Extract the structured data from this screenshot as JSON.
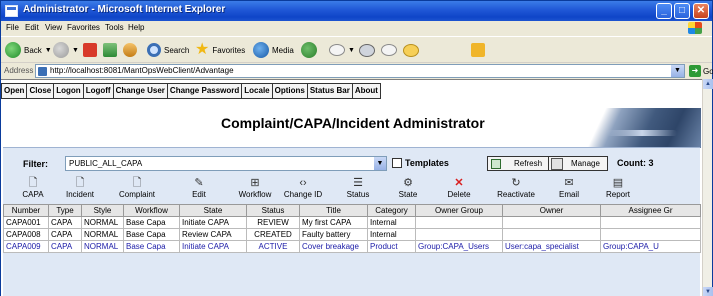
{
  "window": {
    "title": "Administrator - Microsoft Internet Explorer"
  },
  "menubar": [
    "File",
    "Edit",
    "View",
    "Favorites",
    "Tools",
    "Help"
  ],
  "toolbar": {
    "back": "Back",
    "search": "Search",
    "favorites": "Favorites",
    "media": "Media"
  },
  "address": {
    "label": "Address",
    "url": "http://localhost:8081/MantOpsWebClient/Advantage",
    "go": "Go"
  },
  "app_menu": [
    "Open",
    "Close",
    "Logon",
    "Logoff",
    "Change User",
    "Change Password",
    "Locale",
    "Options",
    "Status Bar",
    "About"
  ],
  "page_title": "Complaint/CAPA/Incident Administrator",
  "filter": {
    "label": "Filter:",
    "value": "PUBLIC_ALL_CAPA",
    "templates_label": "Templates",
    "refresh": "Refresh",
    "manage": "Manage",
    "count_label": "Count: 3"
  },
  "actions": [
    {
      "l1": "",
      "l2": "CAPA",
      "icon": "new-capa-icon"
    },
    {
      "l1": "",
      "l2": "Incident",
      "icon": "new-incident-icon"
    },
    {
      "l1": "",
      "l2": "Complaint",
      "icon": "new-complaint-icon"
    },
    {
      "l1": "",
      "l2": "Edit",
      "icon": "edit-icon"
    },
    {
      "l1": "",
      "l2": "Workflow",
      "icon": "workflow-icon"
    },
    {
      "l1": "",
      "l2": "Change ID",
      "icon": "change-id-icon"
    },
    {
      "l1": "",
      "l2": "Status",
      "icon": "status-icon"
    },
    {
      "l1": "",
      "l2": "State",
      "icon": "state-icon"
    },
    {
      "l1": "",
      "l2": "Delete",
      "icon": "delete-icon"
    },
    {
      "l1": "",
      "l2": "Reactivate",
      "icon": "reactivate-icon"
    },
    {
      "l1": "",
      "l2": "Email",
      "icon": "email-icon"
    },
    {
      "l1": "",
      "l2": "Report",
      "icon": "report-icon"
    }
  ],
  "grid": {
    "columns": [
      "Number",
      "Type",
      "Style",
      "Workflow",
      "State",
      "Status",
      "Title",
      "Category",
      "Owner Group",
      "Owner",
      "Assignee Gr"
    ],
    "rows": [
      [
        "CAPA001",
        "CAPA",
        "NORMAL",
        "Base Capa",
        "Initiate CAPA",
        "REVIEW",
        "My first CAPA",
        "Internal",
        "",
        "",
        ""
      ],
      [
        "CAPA008",
        "CAPA",
        "NORMAL",
        "Base Capa",
        "Review CAPA",
        "CREATED",
        "Faulty battery",
        "Internal",
        "",
        "",
        ""
      ],
      [
        "CAPA009",
        "CAPA",
        "NORMAL",
        "Base Capa",
        "Initiate CAPA",
        "ACTIVE",
        "Cover breakage",
        "Product",
        "Group:CAPA_Users",
        "User:capa_specialist",
        "Group:CAPA_U"
      ]
    ]
  }
}
